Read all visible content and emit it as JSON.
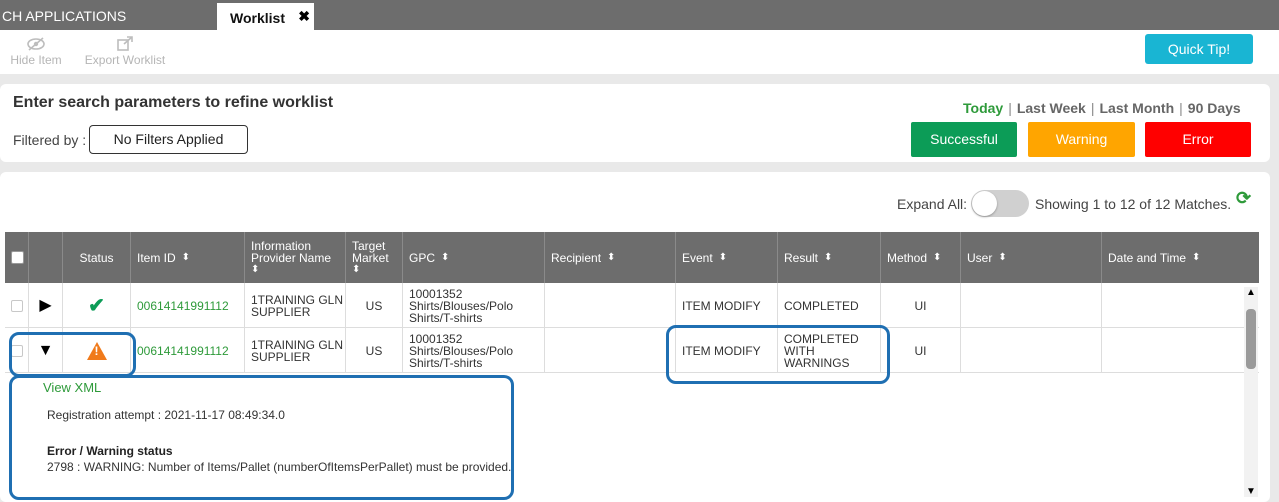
{
  "tabs": {
    "app_tab": "CH APPLICATIONS",
    "worklist_tab": "Worklist",
    "close": "✖"
  },
  "toolbar": {
    "hide_item": "Hide Item",
    "export_worklist": "Export Worklist",
    "quick_tip": "Quick Tip!"
  },
  "filter": {
    "title": "Enter search parameters to refine worklist",
    "filtered_by_label": "Filtered by :",
    "filter_value": "No Filters Applied",
    "ranges": [
      "Today",
      "Last Week",
      "Last Month",
      "90 Days"
    ],
    "active_range": "Today",
    "status_buttons": {
      "successful": "Successful",
      "warning": "Warning",
      "error": "Error"
    }
  },
  "results": {
    "expand_all_label": "Expand All:",
    "showing_text": "Showing 1 to 12 of 12 Matches."
  },
  "table": {
    "columns": {
      "status": "Status",
      "item_id": "Item ID",
      "info_provider": "Information Provider Name",
      "target_market": "Target Market",
      "gpc": "GPC",
      "recipient": "Recipient",
      "event": "Event",
      "result": "Result",
      "method": "Method",
      "user": "User",
      "date_time": "Date and Time"
    },
    "rows": [
      {
        "status_icon": "check-icon",
        "item_id": "00614141991112",
        "info_provider": "1TRAINING GLN SUPPLIER",
        "target_market": "US",
        "gpc": "10001352 Shirts/Blouses/Polo Shirts/T-shirts",
        "recipient": "",
        "event": "ITEM MODIFY",
        "result": "COMPLETED",
        "method": "UI",
        "user": "",
        "date_time": ""
      },
      {
        "status_icon": "warning-icon",
        "item_id": "00614141991112",
        "info_provider": "1TRAINING GLN SUPPLIER",
        "target_market": "US",
        "gpc": "10001352 Shirts/Blouses/Polo Shirts/T-shirts",
        "recipient": "",
        "event": "ITEM MODIFY",
        "result": "COMPLETED WITH WARNINGS",
        "method": "UI",
        "user": "",
        "date_time": ""
      }
    ],
    "detail": {
      "view_xml": "View XML",
      "registration_attempt": "Registration attempt : 2021-11-17 08:49:34.0",
      "error_title": "Error / Warning status",
      "error_message": "2798 : WARNING: Number of Items/Pallet (numberOfItemsPerPallet) must be provided."
    }
  },
  "colors": {
    "accent_green": "#2e9a3a",
    "success": "#0c9c57",
    "warning": "#ffa500",
    "error": "#ff0000",
    "quick_tip": "#19b5d3",
    "highlight": "#1f6fb2"
  }
}
